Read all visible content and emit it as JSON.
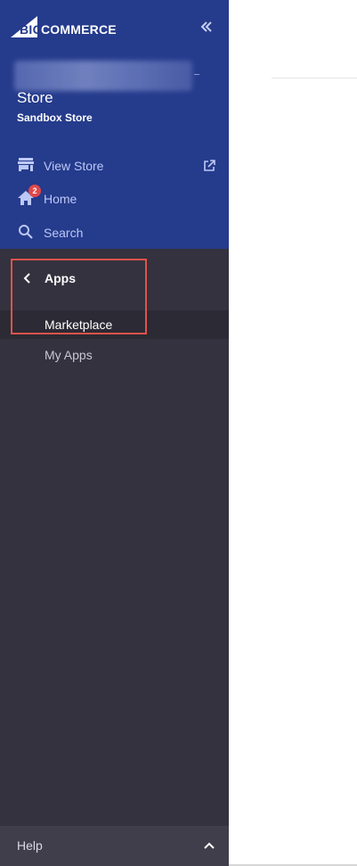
{
  "brand": {
    "logo_big": "BIG",
    "logo_commerce": "COMMERCE"
  },
  "store": {
    "name": "Store",
    "type": "Sandbox Store"
  },
  "nav": [
    {
      "label": "View Store",
      "icon": "storefront-icon"
    },
    {
      "label": "Home",
      "icon": "home-icon",
      "badge": "2"
    },
    {
      "label": "Search",
      "icon": "search-icon"
    }
  ],
  "section": {
    "title": "Apps"
  },
  "subnav": [
    {
      "label": "Marketplace",
      "active": true
    },
    {
      "label": "My Apps",
      "active": false
    }
  ],
  "footer": {
    "help_label": "Help"
  },
  "colors": {
    "sidebar_top": "#253b8c",
    "sidebar_body": "#34323e",
    "highlight": "#e0534a",
    "badge": "#e04848"
  }
}
